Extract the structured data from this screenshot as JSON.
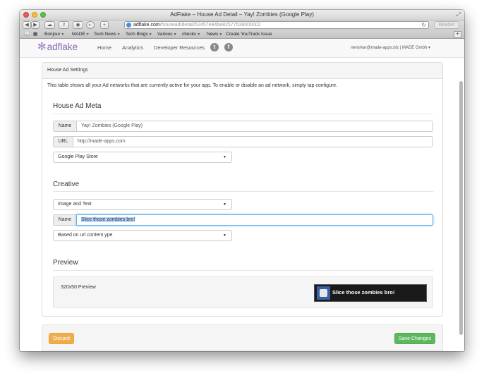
{
  "window": {
    "title": "AdFlake – House Ad Detail – Yay! Zombies (Google Play)"
  },
  "toolbar": {
    "back": "◀",
    "forward": "▶",
    "icloud": "☁",
    "share": "⇪",
    "rss": "◉",
    "plus": "+",
    "url_host": "adflake.com",
    "url_path": "/housead/detail/52457e84be82577536000002",
    "reload": "↻",
    "reader": "Reader"
  },
  "bookmarks": {
    "items": [
      "Bookmarks",
      "Bonjour",
      "MADE",
      "Tech News",
      "Tech Blogs",
      "Various",
      "checks",
      "News",
      "Create YouTrack Issue"
    ]
  },
  "navbar": {
    "brand": "adflake",
    "links": [
      "Home",
      "Analytics",
      "Developer Resources"
    ],
    "social": {
      "twitter": "t",
      "facebook": "f"
    },
    "user": "nerurkar@made-apps.biz | MADE Gmbh ▾"
  },
  "panel": {
    "heading": "House Ad Settings",
    "description": "This table shows all your Ad networks that are currently active for your app. To enable or disable an ad network, simply tap configure."
  },
  "meta": {
    "title": "House Ad Meta",
    "name_label": "Name",
    "name_value": "Yay! Zombies (Google Play)",
    "url_label": "URL",
    "url_value": "http://made-apps.com",
    "store_select": "Google Play Store"
  },
  "creative": {
    "title": "Creative",
    "type_select": "Image and Text",
    "name_label": "Name",
    "name_value": "Slice those zombies bro!",
    "content_select": "Based on url content ype"
  },
  "preview": {
    "title": "Preview",
    "label": "320x50 Preview",
    "banner_text": "Slice those zombies bro!"
  },
  "footer": {
    "discard": "Discard",
    "save": "Save Changes"
  }
}
